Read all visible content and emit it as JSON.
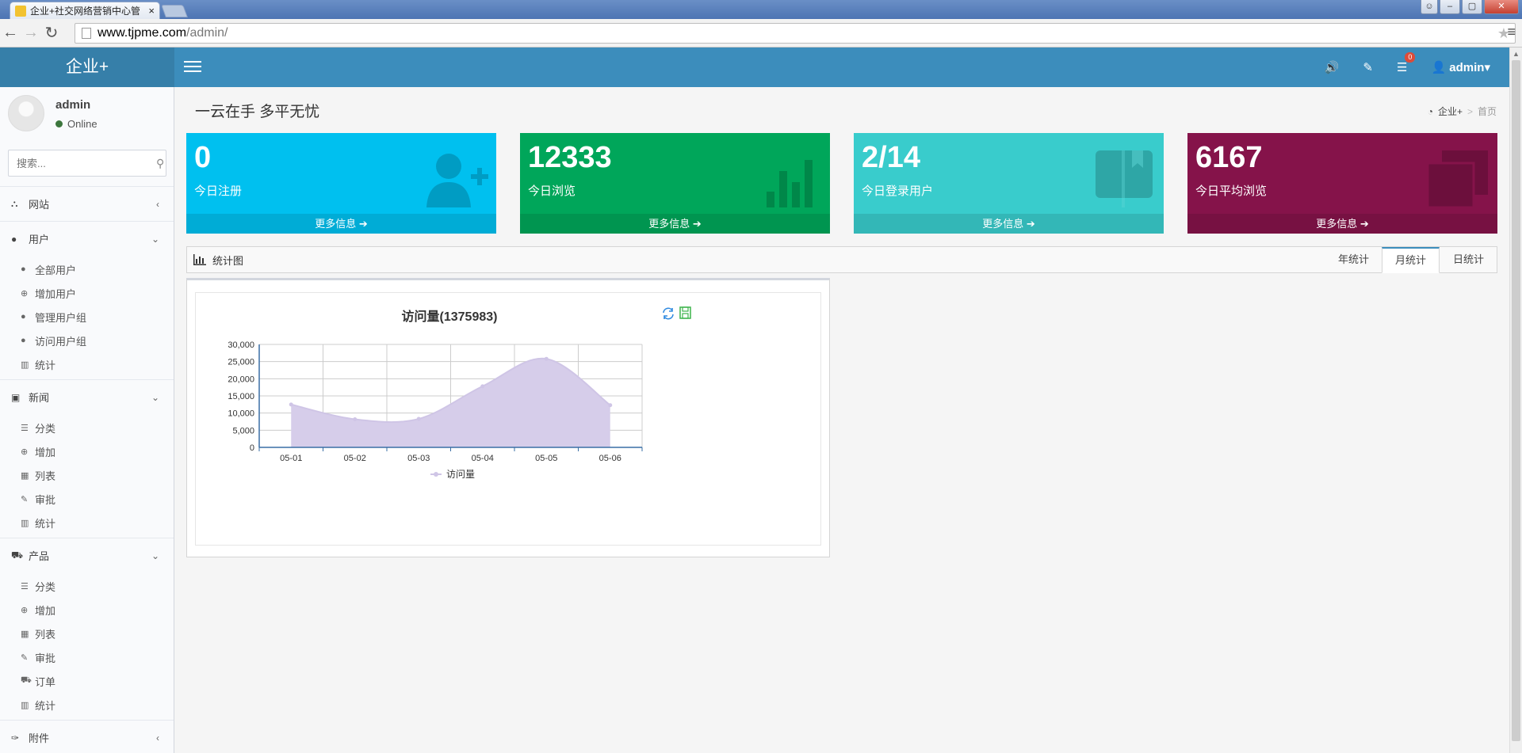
{
  "browser": {
    "tab_title": "企业+社交网络营销中心管",
    "tab_close": "×",
    "url_host": "www.tjpme.com",
    "url_path": "/admin/",
    "back_glyph": "←",
    "forward_glyph": "→",
    "reload_glyph": "↻",
    "star_glyph": "★",
    "menu_glyph": "≡",
    "win_buttons": {
      "minimize": "–",
      "maximize": "▢",
      "close": "✕",
      "user": "☺"
    }
  },
  "app": {
    "logo": "企业+",
    "topbar": {
      "sound_icon": "🔊",
      "edit_icon": "✎",
      "tasks_icon": "☰",
      "tasks_badge": "0",
      "user_glyph": "👤",
      "user_label": "admin▾"
    }
  },
  "sidebar": {
    "user_name": "admin",
    "user_status": "Online",
    "search_placeholder": "搜索...",
    "search_icon": "⚲",
    "sections": [
      {
        "label": "网站",
        "icon": "⛬",
        "chevron": "‹",
        "items": []
      },
      {
        "label": "用户",
        "icon": "●",
        "chevron": "⌄",
        "items": [
          {
            "label": "全部用户",
            "icon": "●"
          },
          {
            "label": "增加用户",
            "icon": "⊕"
          },
          {
            "label": "管理用户组",
            "icon": "●"
          },
          {
            "label": "访问用户组",
            "icon": "●"
          },
          {
            "label": "统计",
            "icon": "▥"
          }
        ]
      },
      {
        "label": "新闻",
        "icon": "▣",
        "chevron": "⌄",
        "items": [
          {
            "label": "分类",
            "icon": "☰"
          },
          {
            "label": "增加",
            "icon": "⊕"
          },
          {
            "label": "列表",
            "icon": "▦"
          },
          {
            "label": "审批",
            "icon": "✎"
          },
          {
            "label": "统计",
            "icon": "▥"
          }
        ]
      },
      {
        "label": "产品",
        "icon": "⛟",
        "chevron": "⌄",
        "items": [
          {
            "label": "分类",
            "icon": "☰"
          },
          {
            "label": "增加",
            "icon": "⊕"
          },
          {
            "label": "列表",
            "icon": "▦"
          },
          {
            "label": "审批",
            "icon": "✎"
          },
          {
            "label": "订单",
            "icon": "⛟"
          },
          {
            "label": "统计",
            "icon": "▥"
          }
        ]
      },
      {
        "label": "附件",
        "icon": "✑",
        "chevron": "‹",
        "items": []
      }
    ]
  },
  "main": {
    "slogan": "一云在手 多平无忧",
    "breadcrumb": {
      "home_icon": "◔",
      "home": "企业+",
      "sep": ">",
      "current": "首页"
    },
    "boxes": [
      {
        "value": "0",
        "label": "今日注册",
        "more": "更多信息 ➔",
        "icon": "user-add-icon"
      },
      {
        "value": "12333",
        "label": "今日浏览",
        "more": "更多信息 ➔",
        "icon": "bar-chart-icon"
      },
      {
        "value": "2/14",
        "label": "今日登录用户",
        "more": "更多信息 ➔",
        "icon": "book-icon"
      },
      {
        "value": "6167",
        "label": "今日平均浏览",
        "more": "更多信息 ➔",
        "icon": "copy-icon"
      }
    ],
    "colors": {
      "aqua": "#00c0ef",
      "green": "#00a65a",
      "teal": "#39cccc",
      "maroon": "#85134a",
      "header": "#3c8dbc"
    },
    "stats_title": "统计图",
    "stats_tabs": [
      "年统计",
      "月统计",
      "日统计"
    ],
    "active_tab": "月统计"
  },
  "chart_data": {
    "type": "area",
    "title": "访问量(1375983)",
    "categories": [
      "05-01",
      "05-02",
      "05-03",
      "05-04",
      "05-05",
      "05-06"
    ],
    "series": [
      {
        "name": "访问量",
        "values": [
          12500,
          8200,
          8300,
          17800,
          25800,
          12300
        ],
        "color": "#d6cdea"
      }
    ],
    "ylim": [
      0,
      30000
    ],
    "yticks": [
      "0",
      "5,000",
      "10,000",
      "15,000",
      "20,000",
      "25,000",
      "30,000"
    ],
    "grid": true,
    "legend": "bottom-center",
    "toolbox": [
      "refresh-icon",
      "save-icon"
    ]
  }
}
